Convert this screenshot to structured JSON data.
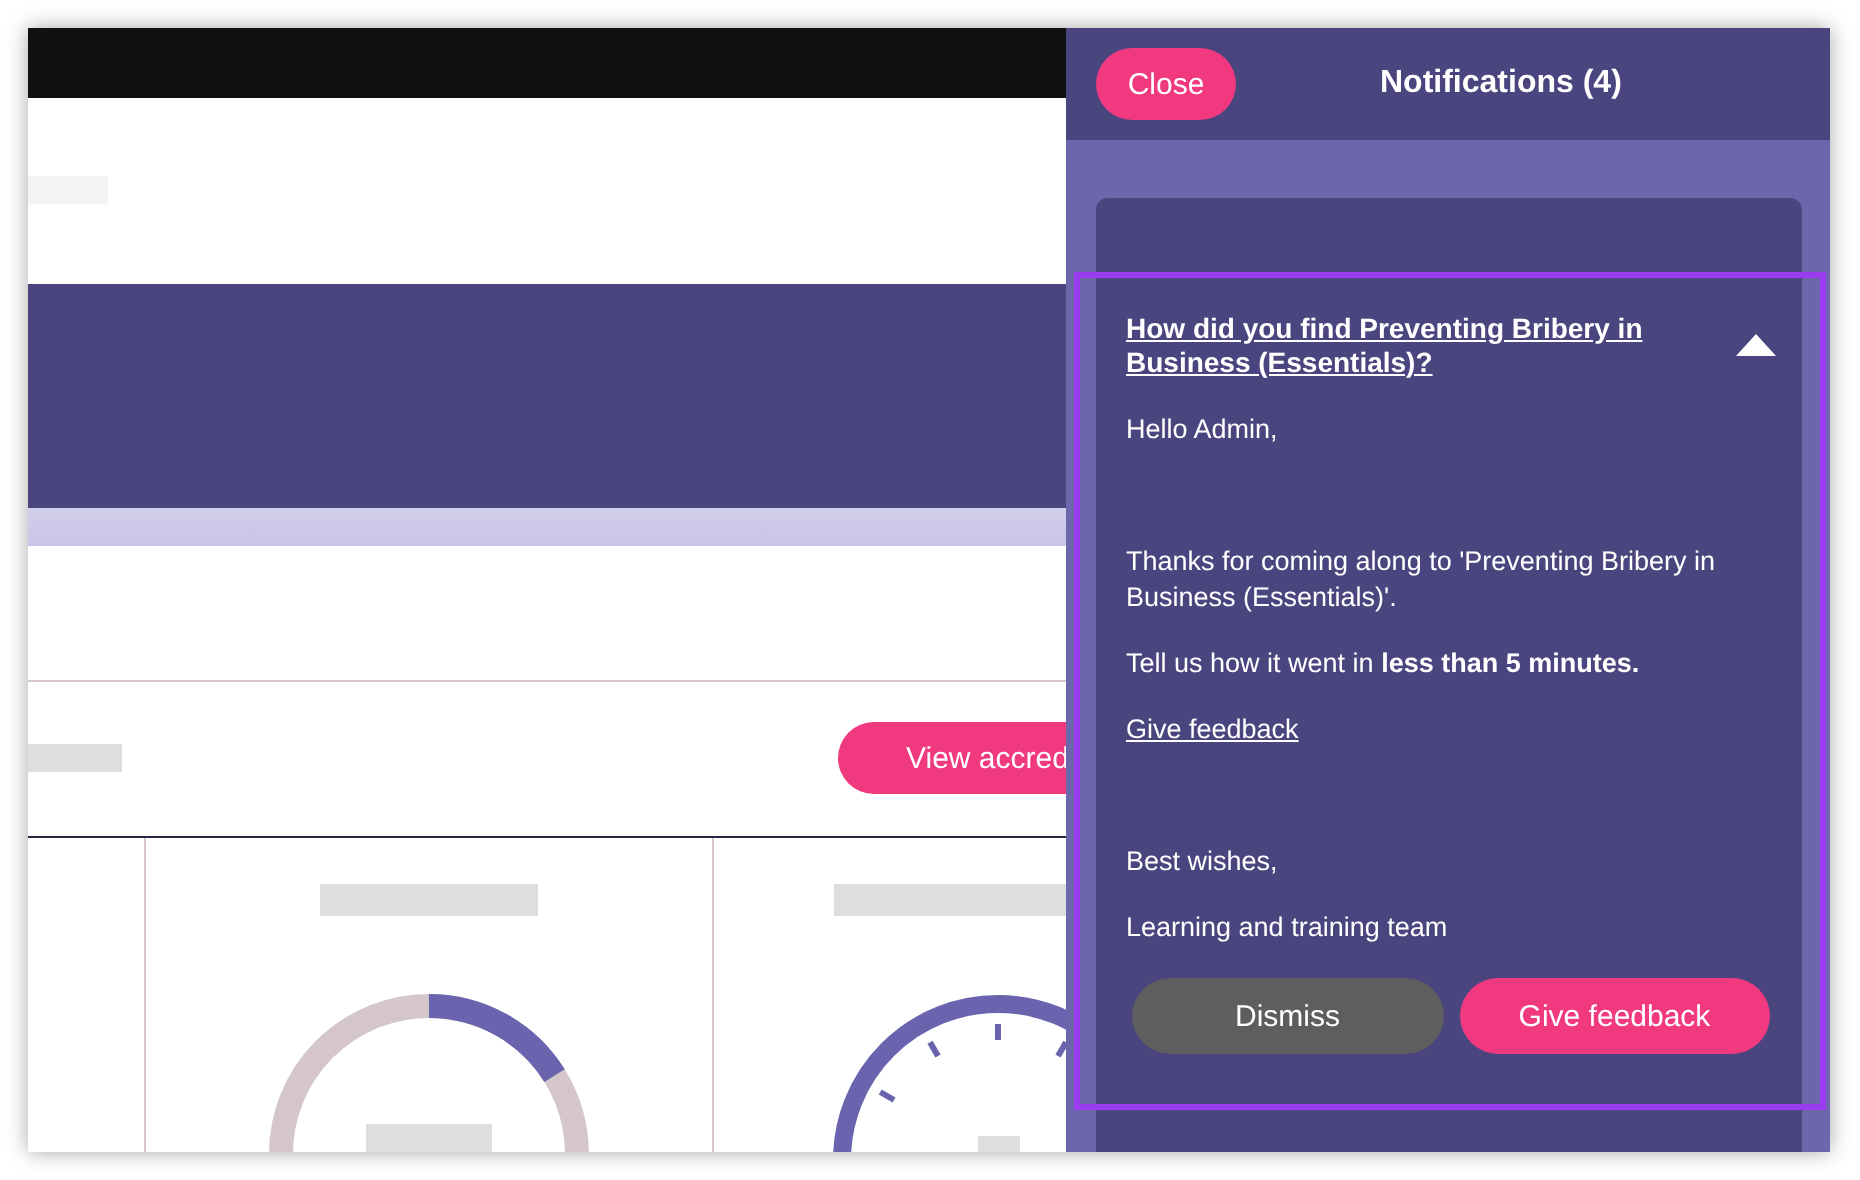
{
  "page": {
    "action_button": {
      "label": "View accred"
    }
  },
  "panel": {
    "close_button": {
      "label": "Close"
    },
    "title": "Notifications (4)",
    "notification": {
      "title": "How did you find Preventing Bribery in Business (Essentials)?",
      "expanded": true,
      "highlighted": true,
      "greeting": "Hello Admin,",
      "paragraphs": [
        "Thanks for coming along to 'Preventing Bribery in Business (Essentials)'.",
        "Tell us how it went in **less than 5 minutes.**"
      ],
      "link": "Give feedback",
      "signoff": "Best wishes,",
      "signature": "Learning and training team",
      "buttons": [
        {
          "label": "Dismiss",
          "kind": "secondary"
        },
        {
          "label": "Give feedback",
          "kind": "primary"
        }
      ]
    }
  }
}
